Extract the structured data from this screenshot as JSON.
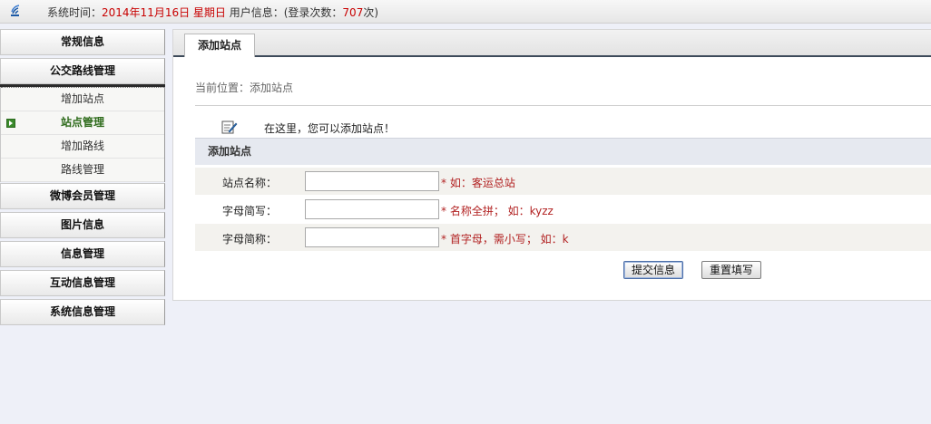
{
  "topbar": {
    "system_time_label": "系统时间：",
    "system_time_value": "2014年11月16日 星期日",
    "user_info_label": " 用户信息：(登录次数：",
    "login_count": "707",
    "login_suffix": "次)"
  },
  "sidebar": {
    "menus": [
      {
        "label": "常规信息"
      },
      {
        "label": "公交路线管理"
      }
    ],
    "sub_items": [
      {
        "label": "增加站点"
      },
      {
        "label": "站点管理"
      },
      {
        "label": "增加路线"
      },
      {
        "label": "路线管理"
      }
    ],
    "menus_after": [
      {
        "label": "微博会员管理"
      },
      {
        "label": "图片信息"
      },
      {
        "label": "信息管理"
      },
      {
        "label": "互动信息管理"
      },
      {
        "label": "系统信息管理"
      }
    ]
  },
  "main": {
    "tab_label": "添加站点",
    "breadcrumb": "当前位置：添加站点",
    "hint": "在这里，您可以添加站点！",
    "form_title": "添加站点",
    "fields": [
      {
        "label": "站点名称：",
        "value": "",
        "note": "* 如：客运总站"
      },
      {
        "label": "字母简写：",
        "value": "",
        "note": "* 名称全拼； 如：kyzz"
      },
      {
        "label": "字母简称：",
        "value": "",
        "note": "* 首字母，需小写； 如：k"
      }
    ],
    "submit_label": "提交信息",
    "reset_label": "重置填写"
  }
}
